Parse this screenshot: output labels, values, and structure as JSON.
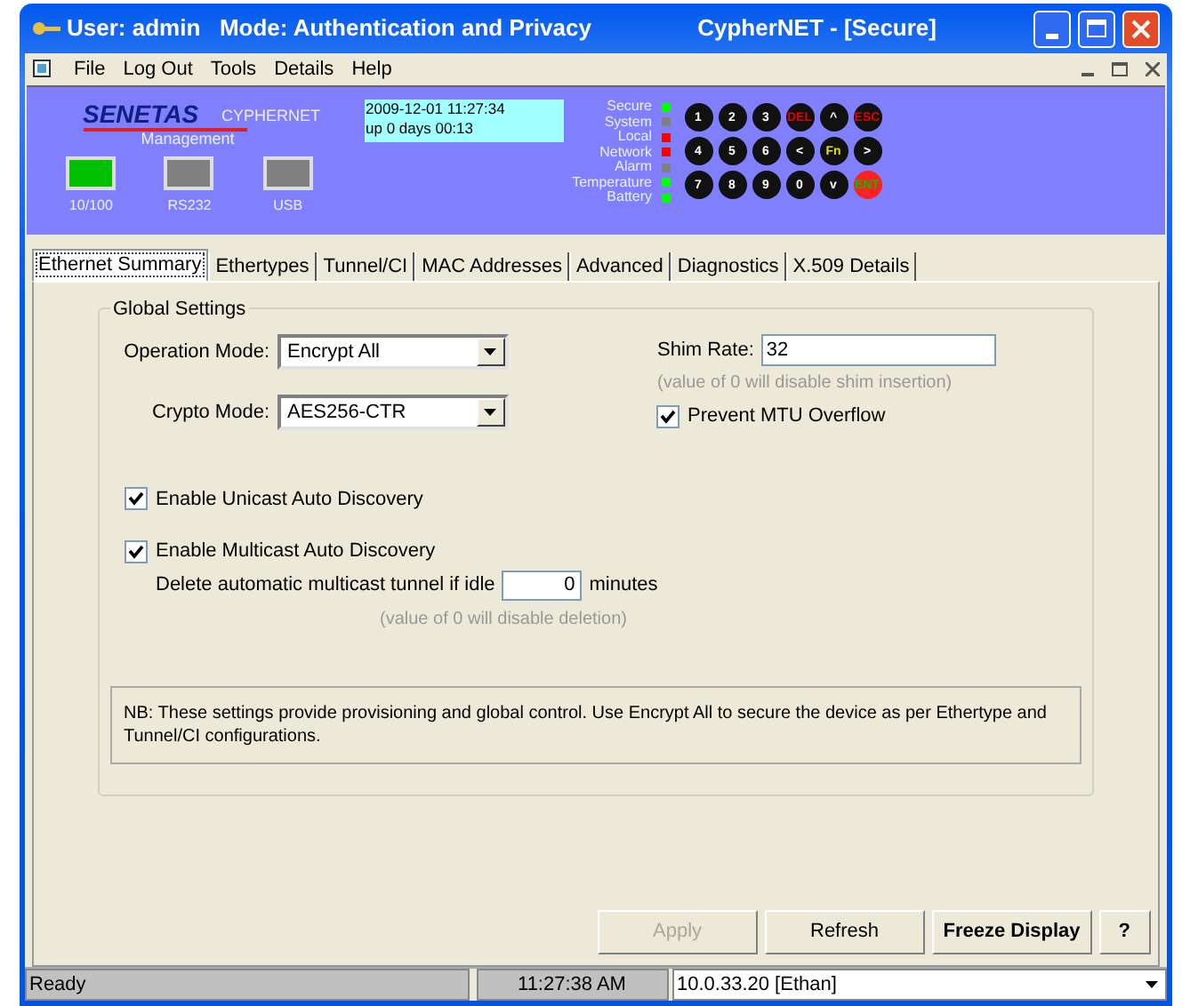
{
  "window": {
    "title_left": "User: admin   Mode: Authentication and Privacy",
    "title_right": "CypherNET - [Secure]"
  },
  "menu": [
    "File",
    "Log Out",
    "Tools",
    "Details",
    "Help"
  ],
  "header": {
    "brand": "SENETAS",
    "product": "CYPHERNET",
    "clock": [
      "2009-12-01 11:27:34",
      "up 0 days 00:13"
    ],
    "management": "Management",
    "ports": [
      {
        "label": "10/100",
        "color": "#00c000"
      },
      {
        "label": "RS232",
        "color": "#808080"
      },
      {
        "label": "USB",
        "color": "#808080"
      }
    ],
    "status": [
      {
        "label": "Secure",
        "color": "#00ff00"
      },
      {
        "label": "System",
        "color": "#808080"
      },
      {
        "label": "Local",
        "color": "#ff0000"
      },
      {
        "label": "Network",
        "color": "#ff0000"
      },
      {
        "label": "Alarm",
        "color": "#808080"
      },
      {
        "label": "Temperature",
        "color": "#00ff00"
      },
      {
        "label": "Battery",
        "color": "#00ff00"
      }
    ],
    "keys": [
      [
        {
          "label": "1",
          "kind": "plain"
        },
        {
          "label": "2",
          "kind": "plain"
        },
        {
          "label": "3",
          "kind": "plain"
        },
        {
          "label": "DEL",
          "kind": "alert"
        },
        {
          "label": "^",
          "kind": "plain"
        },
        {
          "label": "ESC",
          "kind": "alert"
        }
      ],
      [
        {
          "label": "4",
          "kind": "plain"
        },
        {
          "label": "5",
          "kind": "plain"
        },
        {
          "label": "6",
          "kind": "plain"
        },
        {
          "label": "<",
          "kind": "plain"
        },
        {
          "label": "Fn",
          "kind": "fn"
        },
        {
          "label": ">",
          "kind": "plain"
        }
      ],
      [
        {
          "label": "7",
          "kind": "plain"
        },
        {
          "label": "8",
          "kind": "plain"
        },
        {
          "label": "9",
          "kind": "plain"
        },
        {
          "label": "0",
          "kind": "plain"
        },
        {
          "label": "v",
          "kind": "plain"
        },
        {
          "label": "ENT",
          "kind": "enter"
        }
      ]
    ]
  },
  "tabs": [
    {
      "label": "Ethernet Summary",
      "selected": true
    },
    {
      "label": "Ethertypes",
      "selected": false
    },
    {
      "label": "Tunnel/CI",
      "selected": false
    },
    {
      "label": "MAC Addresses",
      "selected": false
    },
    {
      "label": "Advanced",
      "selected": false
    },
    {
      "label": "Diagnostics",
      "selected": false
    },
    {
      "label": "X.509 Details",
      "selected": false
    }
  ],
  "global_settings": {
    "title": "Global Settings",
    "operation_mode": {
      "label": "Operation Mode:",
      "value": "Encrypt All"
    },
    "crypto_mode": {
      "label": "Crypto Mode:",
      "value": "AES256-CTR"
    },
    "shim_rate": {
      "label": "Shim Rate:",
      "value": "32",
      "hint": "(value of 0 will disable shim insertion)"
    },
    "prevent_mtu": {
      "label": "Prevent MTU Overflow",
      "checked": true
    },
    "unicast": {
      "label": "Enable Unicast Auto Discovery",
      "checked": true
    },
    "multicast": {
      "label": "Enable Multicast Auto Discovery",
      "checked": true
    },
    "idle": {
      "label": "Delete automatic multicast tunnel if idle",
      "value": "0",
      "unit": "minutes",
      "hint": "(value of 0 will disable deletion)"
    },
    "note": "NB: These settings provide provisioning and global control. Use Encrypt All to secure the device as per Ethertype and Tunnel/CI configurations."
  },
  "buttons": [
    {
      "label": "Apply",
      "disabled": true,
      "bold": false
    },
    {
      "label": "Refresh",
      "disabled": false,
      "bold": false
    },
    {
      "label": "Freeze Display",
      "disabled": false,
      "bold": true
    },
    {
      "label": "?",
      "disabled": false,
      "bold": true
    }
  ],
  "status_bar": {
    "message": "Ready",
    "time": "11:27:38 AM",
    "device": "10.0.33.20 [Ethan]"
  }
}
